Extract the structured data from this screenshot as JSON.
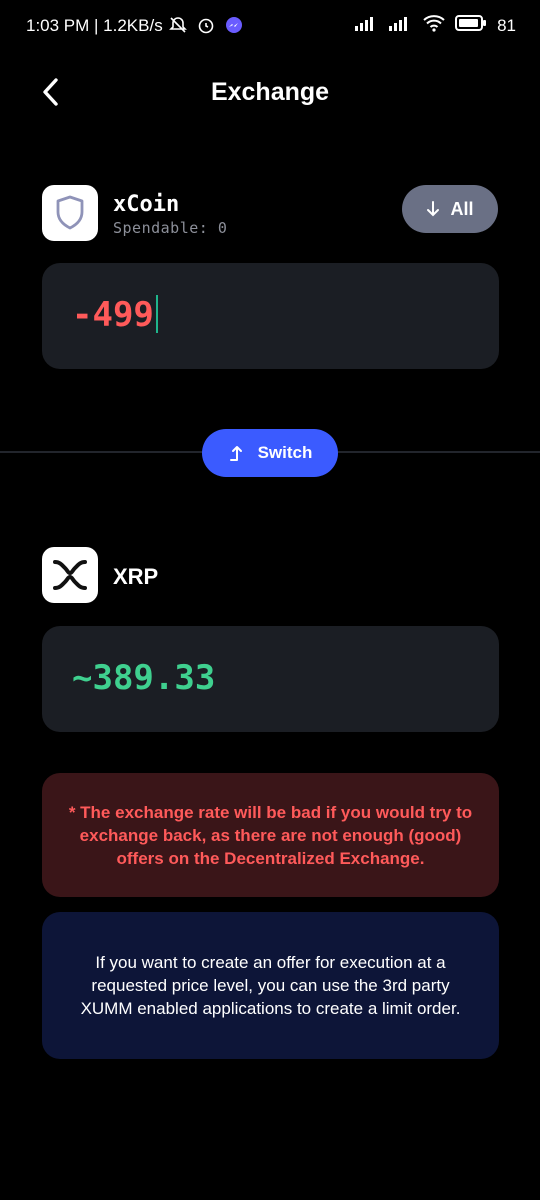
{
  "status_bar": {
    "time": "1:03 PM | 1.2KB/s",
    "battery": "81"
  },
  "header": {
    "title": "Exchange"
  },
  "from_coin": {
    "name": "xCoin",
    "spendable": "Spendable: 0",
    "amount": "-499",
    "amount_color": "#ff5a5a"
  },
  "all_button": {
    "label": "All"
  },
  "switch_button": {
    "label": "Switch"
  },
  "to_coin": {
    "name": "XRP",
    "amount": "~389.33",
    "amount_color": "#3fd08f"
  },
  "warning": {
    "text": "* The exchange rate will be bad if you would try to exchange back, as there are not enough (good) offers on the Decentralized Exchange."
  },
  "info": {
    "text": "If you want to create an offer for execution at a requested price level, you can use the 3rd party XUMM enabled applications to create a limit order."
  },
  "colors": {
    "background": "#000000",
    "switch_button": "#3b5bff",
    "all_button": "#6a7085",
    "warning_bg": "#3a1518",
    "info_bg": "#0d1538"
  }
}
